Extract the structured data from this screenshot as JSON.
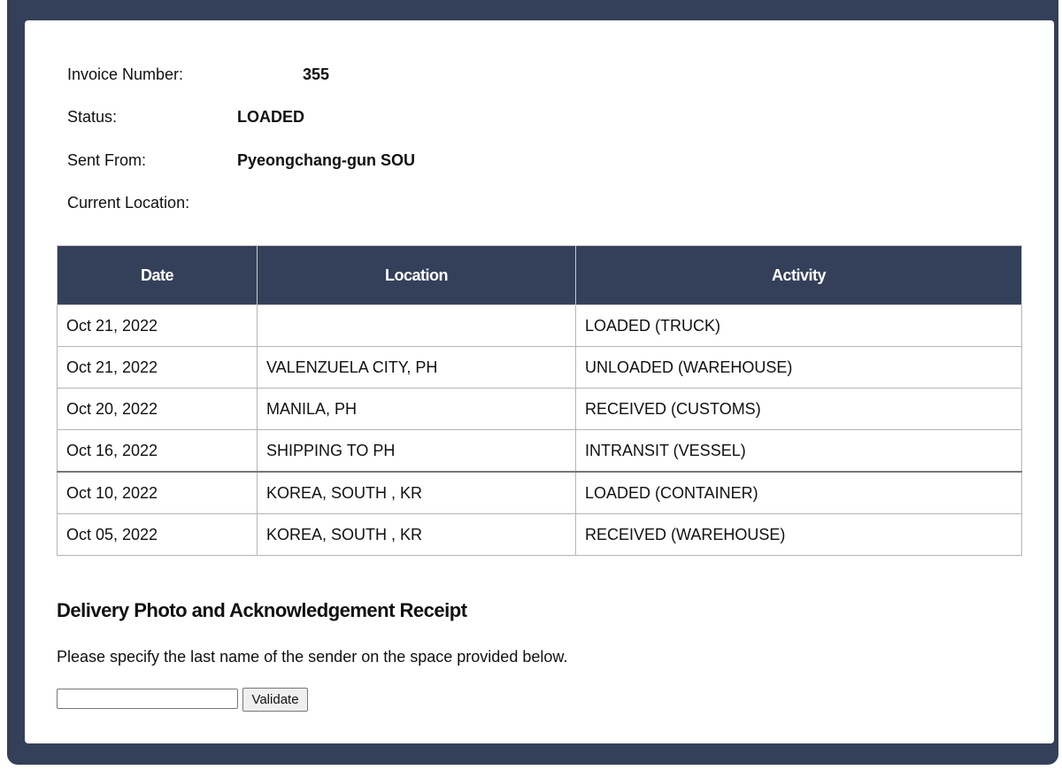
{
  "shipment": {
    "invoice_label": "Invoice Number:",
    "invoice_value": "355",
    "status_label": "Status:",
    "status_value": "LOADED",
    "sent_from_label": "Sent From:",
    "sent_from_value": "Pyeongchang-gun SOU",
    "current_location_label": "Current Location:",
    "current_location_value": ""
  },
  "table": {
    "headers": [
      "Date",
      "Location",
      "Activity"
    ],
    "rows": [
      {
        "date": "Oct 21, 2022",
        "location": "",
        "activity": "LOADED (TRUCK)"
      },
      {
        "date": "Oct 21, 2022",
        "location": "VALENZUELA CITY, PH",
        "activity": "UNLOADED (WAREHOUSE)"
      },
      {
        "date": "Oct 20, 2022",
        "location": "MANILA, PH",
        "activity": "RECEIVED (CUSTOMS)"
      },
      {
        "date": "Oct 16, 2022",
        "location": "SHIPPING TO PH",
        "activity": "INTRANSIT (VESSEL)"
      },
      {
        "date": "Oct 10, 2022",
        "location": "KOREA, SOUTH , KR",
        "activity": "LOADED (CONTAINER)"
      },
      {
        "date": "Oct 05, 2022",
        "location": "KOREA, SOUTH , KR",
        "activity": "RECEIVED (WAREHOUSE)"
      }
    ]
  },
  "receipt": {
    "title": "Delivery Photo and Acknowledgement Receipt",
    "instruction": "Please specify the last name of the sender on the space provided below.",
    "input_value": "",
    "validate_label": "Validate"
  },
  "colors": {
    "frame": "#344059",
    "header_bg": "#344059",
    "header_text": "#ffffff",
    "card_bg": "#ffffff"
  }
}
